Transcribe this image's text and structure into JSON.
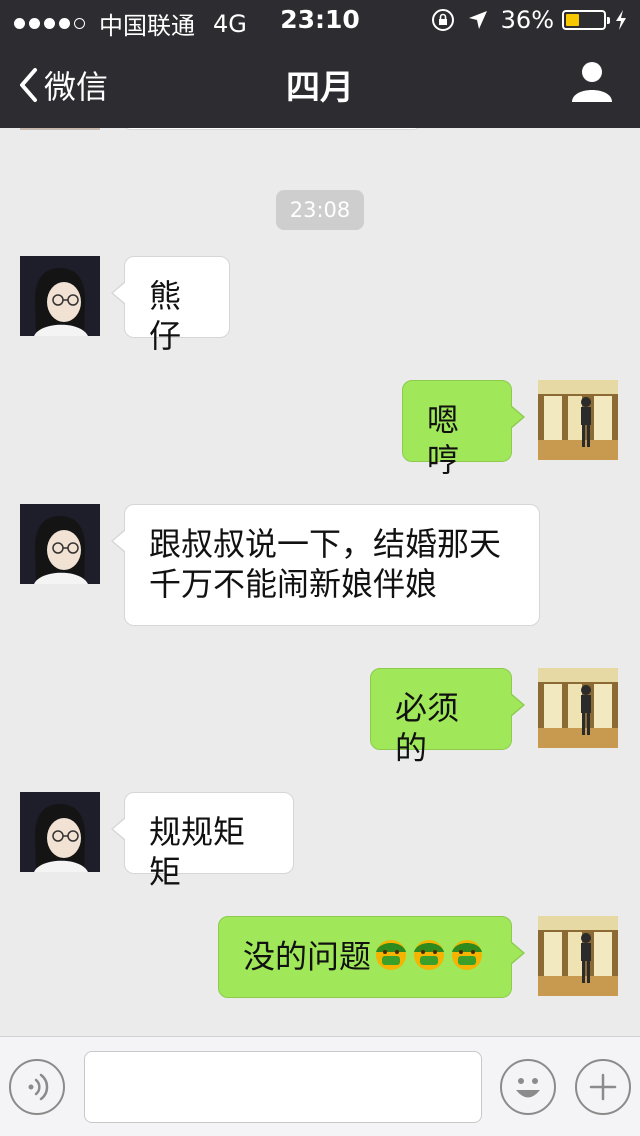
{
  "status_bar": {
    "carrier": "中国联通",
    "network": "4G",
    "time": "23:10",
    "battery_percent_text": "36%",
    "battery_level": 0.36
  },
  "nav": {
    "back_label": "微信",
    "title": "四月"
  },
  "chat": {
    "timestamp": "23:08",
    "messages": [
      {
        "side": "in",
        "text": "熊仔"
      },
      {
        "side": "out",
        "text": "嗯哼"
      },
      {
        "side": "in",
        "lines": [
          "跟叔叔说一下，结婚那天",
          "千万不能闹新娘伴娘"
        ]
      },
      {
        "side": "out",
        "text": "必须的"
      },
      {
        "side": "in",
        "text": "规规矩矩"
      },
      {
        "side": "out",
        "text": "没的问题",
        "emoji_count": 3,
        "emoji_icon": "money-mouth-face-icon"
      }
    ]
  },
  "input_bar": {
    "voice_icon": "voice-icon",
    "emoji_icon": "smiley-icon",
    "more_icon": "plus-icon",
    "value": ""
  },
  "colors": {
    "bar_bg": "#2d2d31",
    "chat_bg": "#ebebeb",
    "bubble_out": "#a0e75a",
    "bubble_in": "#ffffff",
    "battery_fill": "#f7c800"
  }
}
